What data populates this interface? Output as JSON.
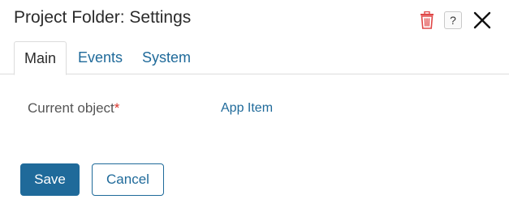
{
  "dialog": {
    "title": "Project Folder: Settings",
    "icons": {
      "delete": "trash-icon",
      "help": "help-icon",
      "close": "close-icon"
    },
    "help_glyph": "?"
  },
  "tabs": [
    {
      "label": "Main",
      "active": true
    },
    {
      "label": "Events",
      "active": false
    },
    {
      "label": "System",
      "active": false
    }
  ],
  "form": {
    "current_object": {
      "label": "Current object",
      "required_mark": "*",
      "value": "App Item"
    }
  },
  "actions": {
    "save_label": "Save",
    "cancel_label": "Cancel"
  },
  "colors": {
    "accent": "#1f6a9a",
    "danger": "#d9342b",
    "text": "#2b2b2b",
    "muted": "#555555",
    "border": "#dcdcdc"
  }
}
